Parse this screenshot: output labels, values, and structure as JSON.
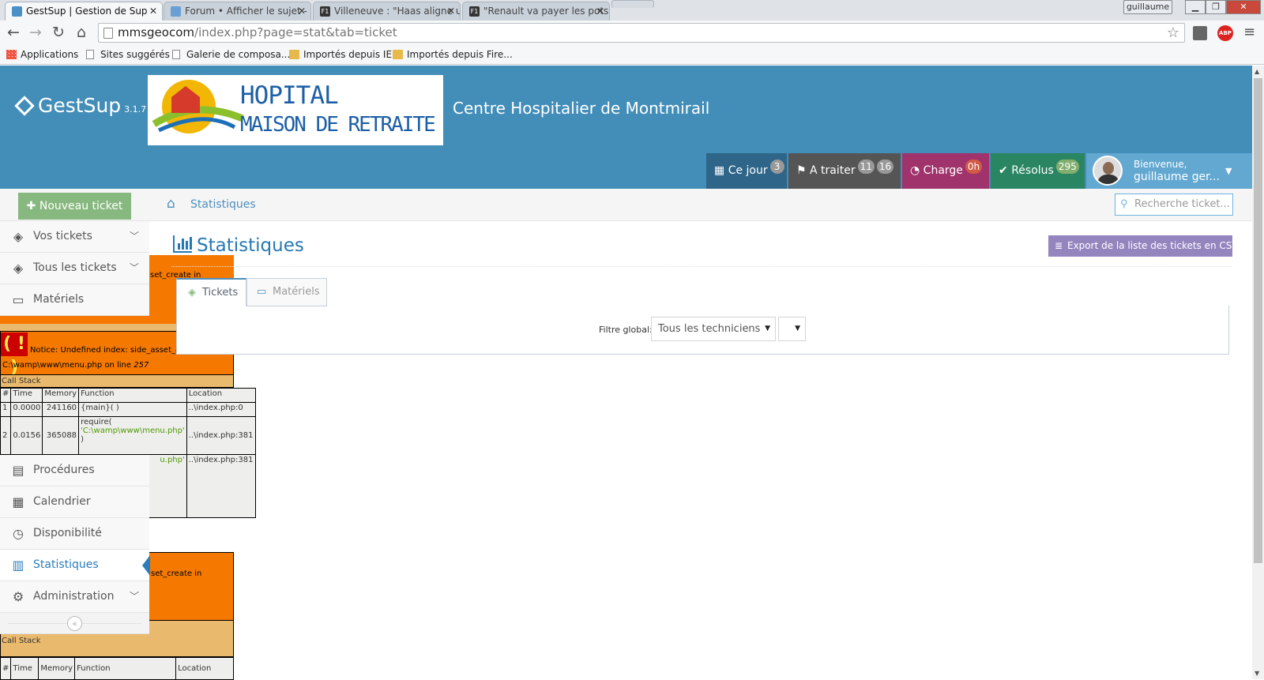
{
  "browser": {
    "tabs": [
      {
        "title": "GestSup | Gestion de Sup",
        "active": true
      },
      {
        "title": "Forum • Afficher le sujet -",
        "active": false
      },
      {
        "title": "Villeneuve : \"Haas aligne u",
        "active": false
      },
      {
        "title": "\"Renault va payer les pots",
        "active": false
      }
    ],
    "user_label": "guillaume",
    "address_host": "mmsgeocom",
    "address_path": "/index.php?page=stat&tab=ticket",
    "bookmarks": [
      "Applications",
      "Sites suggérés",
      "Galerie de composa...",
      "Importés depuis IE",
      "Importés depuis Fire..."
    ],
    "adblock_label": "ABP"
  },
  "header": {
    "brand": "GestSup",
    "version": "3.1.7",
    "logo_line1": "HOPITAL",
    "logo_line2": "MAISON DE RETRAITE",
    "site_title": "Centre Hospitalier de Montmirail",
    "buttons": [
      {
        "label": "Ce jour",
        "badges": [
          "3"
        ],
        "color": "#2e6589"
      },
      {
        "label": "A traiter",
        "badges": [
          "11",
          "16"
        ],
        "color": "#555555"
      },
      {
        "label": "Charge",
        "badges": [
          "0h"
        ],
        "color": "#b74635"
      },
      {
        "label": "Résolus",
        "badges": [
          "295"
        ],
        "color": "#629b58"
      }
    ],
    "welcome": "Bienvenue,",
    "username": "guillaume ger..."
  },
  "actions": {
    "new_ticket": "Nouveau ticket"
  },
  "breadcrumb": {
    "current": "Statistiques"
  },
  "search": {
    "placeholder": "Recherche ticket..."
  },
  "sidebar": {
    "items": [
      {
        "label": "Vos tickets",
        "icon": "ticket-icon"
      },
      {
        "label": "Tous les tickets",
        "icon": "ticket-icon"
      },
      {
        "label": "Matériels",
        "icon": "desktop-icon"
      },
      {
        "label": "Procédures",
        "icon": "book-icon"
      },
      {
        "label": "Calendrier",
        "icon": "calendar-icon"
      },
      {
        "label": "Disponibilité",
        "icon": "clock-icon"
      },
      {
        "label": "Statistiques",
        "icon": "bar-chart-icon"
      },
      {
        "label": "Administration",
        "icon": "cogs-icon"
      }
    ]
  },
  "xdebug": {
    "fragment_top": "set_create in",
    "notice": "Notice: Undefined index: side_asset_all_state in",
    "file_prefix": "C:\\wamp\\www\\menu.php on line ",
    "line": "257",
    "call_stack": "Call Stack",
    "headers": [
      "#",
      "Time",
      "Memory",
      "Function",
      "Location"
    ],
    "rows": [
      [
        "1",
        "0.0000",
        "241160",
        "{main}( )",
        "..\\index.php:0"
      ],
      [
        "2",
        "0.0156",
        "365088",
        "require(",
        "..\\index.php:381"
      ]
    ],
    "require_path": "'C:\\wamp\\www\\menu.php'",
    "require_close": ")",
    "fragment_row3_fn": "u.php'",
    "fragment_row3_loc": "..\\index.php:381",
    "fragment_bottom": "set_create in",
    "call_stack_bottom": "Call Stack"
  },
  "main": {
    "title": "Statistiques",
    "export_label": "Export de la liste des tickets en CSV",
    "tabs": [
      "Tickets",
      "Matériels"
    ],
    "filter_label": "Filtre global:",
    "technician_select": "Tous les techniciens",
    "second_select": ""
  }
}
